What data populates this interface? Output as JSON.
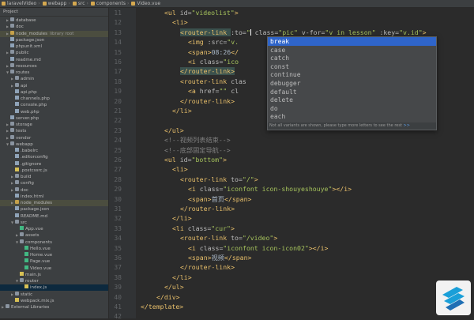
{
  "breadcrumb": [
    "laravelVideo",
    "webapp",
    "src",
    "components",
    "Video.vue"
  ],
  "sidebar": {
    "header": "Project",
    "tree": [
      {
        "d": 1,
        "label": "database",
        "kind": "folder",
        "open": false
      },
      {
        "d": 1,
        "label": "doc",
        "kind": "folder",
        "open": false
      },
      {
        "d": 1,
        "label": "node_modules",
        "kind": "folder",
        "open": false,
        "extra": "library root",
        "hl": true
      },
      {
        "d": 1,
        "label": "package.json",
        "kind": "file"
      },
      {
        "d": 1,
        "label": "phpunit.xml",
        "kind": "file"
      },
      {
        "d": 1,
        "label": "public",
        "kind": "folder",
        "open": false
      },
      {
        "d": 1,
        "label": "readme.md",
        "kind": "file"
      },
      {
        "d": 1,
        "label": "resources",
        "kind": "folder",
        "open": false
      },
      {
        "d": 1,
        "label": "routes",
        "kind": "folder",
        "open": true
      },
      {
        "d": 2,
        "label": "admin",
        "kind": "folder",
        "open": false
      },
      {
        "d": 2,
        "label": "api",
        "kind": "folder",
        "open": false
      },
      {
        "d": 2,
        "label": "api.php",
        "kind": "file"
      },
      {
        "d": 2,
        "label": "channels.php",
        "kind": "file"
      },
      {
        "d": 2,
        "label": "console.php",
        "kind": "file"
      },
      {
        "d": 2,
        "label": "web.php",
        "kind": "file"
      },
      {
        "d": 1,
        "label": "server.php",
        "kind": "file"
      },
      {
        "d": 1,
        "label": "storage",
        "kind": "folder",
        "open": false
      },
      {
        "d": 1,
        "label": "tests",
        "kind": "folder",
        "open": false
      },
      {
        "d": 1,
        "label": "vendor",
        "kind": "folder",
        "open": false
      },
      {
        "d": 1,
        "label": "webapp",
        "kind": "folder",
        "open": true
      },
      {
        "d": 2,
        "label": ".babelrc",
        "kind": "file"
      },
      {
        "d": 2,
        "label": ".editorconfig",
        "kind": "file"
      },
      {
        "d": 2,
        "label": ".gitignore",
        "kind": "file"
      },
      {
        "d": 2,
        "label": ".postcssrc.js",
        "kind": "js"
      },
      {
        "d": 2,
        "label": "build",
        "kind": "folder",
        "open": false
      },
      {
        "d": 2,
        "label": "config",
        "kind": "folder",
        "open": false
      },
      {
        "d": 2,
        "label": "doc",
        "kind": "folder",
        "open": false
      },
      {
        "d": 2,
        "label": "index.html",
        "kind": "file"
      },
      {
        "d": 2,
        "label": "node_modules",
        "kind": "folder",
        "open": false,
        "hl": true
      },
      {
        "d": 2,
        "label": "package.json",
        "kind": "file"
      },
      {
        "d": 2,
        "label": "README.md",
        "kind": "file"
      },
      {
        "d": 2,
        "label": "src",
        "kind": "folder",
        "open": true
      },
      {
        "d": 3,
        "label": "App.vue",
        "kind": "vue"
      },
      {
        "d": 3,
        "label": "assets",
        "kind": "folder",
        "open": false
      },
      {
        "d": 3,
        "label": "components",
        "kind": "folder",
        "open": true
      },
      {
        "d": 4,
        "label": "Hello.vue",
        "kind": "vue"
      },
      {
        "d": 4,
        "label": "Home.vue",
        "kind": "vue"
      },
      {
        "d": 4,
        "label": "Page.vue",
        "kind": "vue"
      },
      {
        "d": 4,
        "label": "Video.vue",
        "kind": "vue"
      },
      {
        "d": 3,
        "label": "main.js",
        "kind": "js"
      },
      {
        "d": 3,
        "label": "router",
        "kind": "folder",
        "open": true
      },
      {
        "d": 4,
        "label": "index.js",
        "kind": "js",
        "sel": true
      },
      {
        "d": 2,
        "label": "static",
        "kind": "folder",
        "open": false
      },
      {
        "d": 2,
        "label": "webpack.mix.js",
        "kind": "js"
      },
      {
        "d": 0,
        "label": "External Libraries",
        "kind": "folder",
        "open": false
      }
    ]
  },
  "line_numbers": [
    "11",
    "12",
    "13",
    "14",
    "15",
    "16",
    "17",
    "18",
    "19",
    "20",
    "21",
    "22",
    "23",
    "24",
    "25",
    "26",
    "27",
    "28",
    "29",
    "30",
    "31",
    "32",
    "33",
    "34",
    "35",
    "36",
    "37",
    "38",
    "39",
    "40",
    "41",
    "42"
  ],
  "code": [
    {
      "i": 6,
      "parts": [
        [
          "t",
          "<ul "
        ],
        [
          "a",
          "id="
        ],
        [
          "v",
          "\"videolist\""
        ],
        [
          "t",
          ">"
        ]
      ]
    },
    {
      "i": 8,
      "parts": [
        [
          "t",
          "<li>"
        ]
      ]
    },
    {
      "i": 10,
      "parts": [
        [
          "tb",
          "<router-link "
        ],
        [
          "a",
          ":to="
        ],
        [
          "v",
          "\""
        ],
        [
          "caret",
          ""
        ],
        [
          "a",
          " class="
        ],
        [
          "v",
          "\"pic\" "
        ],
        [
          "a",
          "v-for="
        ],
        [
          "v",
          "\"v in lesson\" "
        ],
        [
          "a",
          ":key="
        ],
        [
          "v",
          "\"v.id\""
        ],
        [
          "t",
          ">"
        ]
      ]
    },
    {
      "i": 12,
      "parts": [
        [
          "t",
          "<img "
        ],
        [
          "a",
          ":src="
        ],
        [
          "v",
          "\"v."
        ]
      ]
    },
    {
      "i": 12,
      "parts": [
        [
          "t",
          "<span>"
        ],
        [
          "x",
          "08:26"
        ],
        [
          "t",
          "</"
        ]
      ]
    },
    {
      "i": 12,
      "parts": [
        [
          "t",
          "<i "
        ],
        [
          "a",
          "class="
        ],
        [
          "v",
          "\"ico"
        ]
      ]
    },
    {
      "i": 10,
      "parts": [
        [
          "tb",
          "</router-link>"
        ]
      ]
    },
    {
      "i": 10,
      "parts": [
        [
          "t",
          "<router-link "
        ],
        [
          "a",
          "clas"
        ]
      ]
    },
    {
      "i": 12,
      "parts": [
        [
          "t",
          "<a "
        ],
        [
          "a",
          "href="
        ],
        [
          "v",
          "\"\" "
        ],
        [
          "a",
          "cl"
        ]
      ]
    },
    {
      "i": 10,
      "parts": [
        [
          "t",
          "</router-link>"
        ]
      ]
    },
    {
      "i": 8,
      "parts": [
        [
          "t",
          "</li>"
        ]
      ]
    },
    {
      "i": 0,
      "parts": [
        [
          "x",
          ""
        ]
      ]
    },
    {
      "i": 6,
      "parts": [
        [
          "t",
          "</ul>"
        ]
      ]
    },
    {
      "i": 6,
      "parts": [
        [
          "c",
          "<!--视频列表结束-->"
        ]
      ]
    },
    {
      "i": 6,
      "parts": [
        [
          "c",
          "<!--底部固定导航-->"
        ]
      ]
    },
    {
      "i": 6,
      "parts": [
        [
          "t",
          "<ul "
        ],
        [
          "a",
          "id="
        ],
        [
          "v",
          "\"bottom\""
        ],
        [
          "t",
          ">"
        ]
      ]
    },
    {
      "i": 8,
      "parts": [
        [
          "t",
          "<li>"
        ]
      ]
    },
    {
      "i": 10,
      "parts": [
        [
          "t",
          "<router-link "
        ],
        [
          "a",
          "to="
        ],
        [
          "v",
          "\"/\""
        ],
        [
          "t",
          ">"
        ]
      ]
    },
    {
      "i": 12,
      "parts": [
        [
          "t",
          "<i "
        ],
        [
          "a",
          "class="
        ],
        [
          "v",
          "\"iconfont icon-shouyeshouye\""
        ],
        [
          "t",
          "></i>"
        ]
      ]
    },
    {
      "i": 12,
      "parts": [
        [
          "t",
          "<span>"
        ],
        [
          "x",
          "首页"
        ],
        [
          "t",
          "</span>"
        ]
      ]
    },
    {
      "i": 10,
      "parts": [
        [
          "t",
          "</router-link>"
        ]
      ]
    },
    {
      "i": 8,
      "parts": [
        [
          "t",
          "</li>"
        ]
      ]
    },
    {
      "i": 8,
      "parts": [
        [
          "t",
          "<li "
        ],
        [
          "a",
          "class="
        ],
        [
          "v",
          "\"cur\""
        ],
        [
          "t",
          ">"
        ]
      ]
    },
    {
      "i": 10,
      "parts": [
        [
          "t",
          "<router-link "
        ],
        [
          "a",
          "to="
        ],
        [
          "v",
          "\"/video\""
        ],
        [
          "t",
          ">"
        ]
      ]
    },
    {
      "i": 12,
      "parts": [
        [
          "t",
          "<i "
        ],
        [
          "a",
          "class="
        ],
        [
          "v",
          "\"iconfont icon-icon02\""
        ],
        [
          "t",
          "></i>"
        ]
      ]
    },
    {
      "i": 12,
      "parts": [
        [
          "t",
          "<span>"
        ],
        [
          "x",
          "视频"
        ],
        [
          "t",
          "</span>"
        ]
      ]
    },
    {
      "i": 10,
      "parts": [
        [
          "t",
          "</router-link>"
        ]
      ]
    },
    {
      "i": 8,
      "parts": [
        [
          "t",
          "</li>"
        ]
      ]
    },
    {
      "i": 6,
      "parts": [
        [
          "t",
          "</ul>"
        ]
      ]
    },
    {
      "i": 4,
      "parts": [
        [
          "t",
          "</div>"
        ]
      ]
    },
    {
      "i": 0,
      "parts": [
        [
          "t",
          "</template>"
        ]
      ]
    },
    {
      "i": 0,
      "parts": [
        [
          "x",
          ""
        ]
      ]
    }
  ],
  "autocomplete": {
    "items": [
      "break",
      "case",
      "catch",
      "const",
      "continue",
      "debugger",
      "default",
      "delete",
      "do",
      "each"
    ],
    "selected": 0,
    "footer_text": "Not all variants are shown, please type more letters to see the rest",
    "footer_link": ">>"
  }
}
